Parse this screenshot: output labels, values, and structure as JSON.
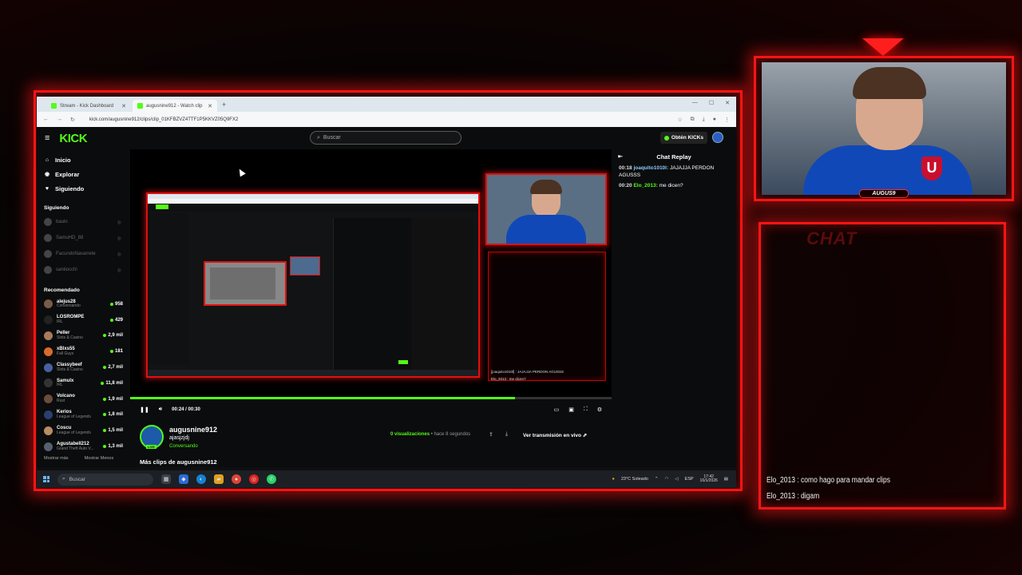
{
  "browser": {
    "tabs": [
      {
        "label": "Stream - Kick Dashboard",
        "active": false
      },
      {
        "label": "augusnine912 - Watch clip",
        "active": true
      }
    ],
    "url": "kick.com/augusnine912/clips/clip_01KFBZVZ4TTF1P5KKVZ05Q9FX2"
  },
  "kick": {
    "logo": "KICK",
    "search_placeholder": "Buscar",
    "kicks_button": "Obtén KICKs",
    "nav": [
      {
        "label": "Inicio",
        "icon": "home-icon"
      },
      {
        "label": "Explorar",
        "icon": "compass-icon"
      },
      {
        "label": "Siguiendo",
        "icon": "heart-icon"
      }
    ],
    "following_heading": "Siguiendo",
    "following": [
      "baulo",
      "SamuHD_88",
      "FacundoNavarrete",
      "santiocchi"
    ],
    "recommended_heading": "Recomendado",
    "recommended": [
      {
        "name": "alejus28",
        "category": "Conversando",
        "viewers": "958",
        "color": "#7a5a48"
      },
      {
        "name": "LOSROMPE",
        "category": "IRL",
        "viewers": "429",
        "color": "#222"
      },
      {
        "name": "Peller",
        "category": "Slots & Casino",
        "viewers": "2,9 mil",
        "color": "#a57b5d"
      },
      {
        "name": "xBlxs55",
        "category": "Fall Guys",
        "viewers": "181",
        "color": "#d96b2c"
      },
      {
        "name": "Classybeef",
        "category": "Slots & Casino",
        "viewers": "2,7 mil",
        "color": "#4a5fa0"
      },
      {
        "name": "Samulx",
        "category": "IRL",
        "viewers": "11,8 mil",
        "color": "#333"
      },
      {
        "name": "Volcano",
        "category": "Rust",
        "viewers": "1,9 mil",
        "color": "#6c4c3a"
      },
      {
        "name": "Kerios",
        "category": "League of Legends",
        "viewers": "1,8 mil",
        "color": "#2b3f6e"
      },
      {
        "name": "Coscu",
        "category": "League of Legends",
        "viewers": "1,5 mil",
        "color": "#b88d63"
      },
      {
        "name": "Agustabell212",
        "category": "Grand Theft Auto V...",
        "viewers": "1,3 mil",
        "color": "#556070"
      }
    ],
    "show_more": "Mostrar más",
    "show_less": "Mostrar Menos"
  },
  "player": {
    "time": "00:24 / 00:30",
    "progress": 0.8
  },
  "clip": {
    "channel": "augusnine912",
    "title": "ajasjzjdj",
    "status": "Conversando",
    "live_tag": "LIVE",
    "views": "0 visualizaciones",
    "ago": "• hace 8 segundos",
    "live_link": "Ver transmisión en vivo ⇗",
    "more_clips": "Más clips de augusnine912"
  },
  "replay": {
    "title": "Chat Replay",
    "messages": [
      {
        "time": "00:18",
        "user": "joaquito1010l:",
        "text": "JAJAJJA PERDON AGUSSS"
      },
      {
        "time": "00:20",
        "user": "Elo_2013:",
        "text": "me dicen?"
      }
    ]
  },
  "inner_video": {
    "chat_lines": [
      "[joaquito1010l] : JAJAJJA PERDON AGUSSS",
      "Elo_2013 : me dicen?"
    ]
  },
  "taskbar": {
    "search": "Buscar",
    "weather": "23°C  Soleado",
    "lang": "ESP",
    "time": "17:42",
    "date": "16/1/2026"
  },
  "overlay": {
    "cam_name": "AUGUS9",
    "chat_title": "CHAT",
    "chat_lines": [
      "Elo_2013 : como hago para mandar clips",
      "Elo_2013 : digam"
    ]
  }
}
